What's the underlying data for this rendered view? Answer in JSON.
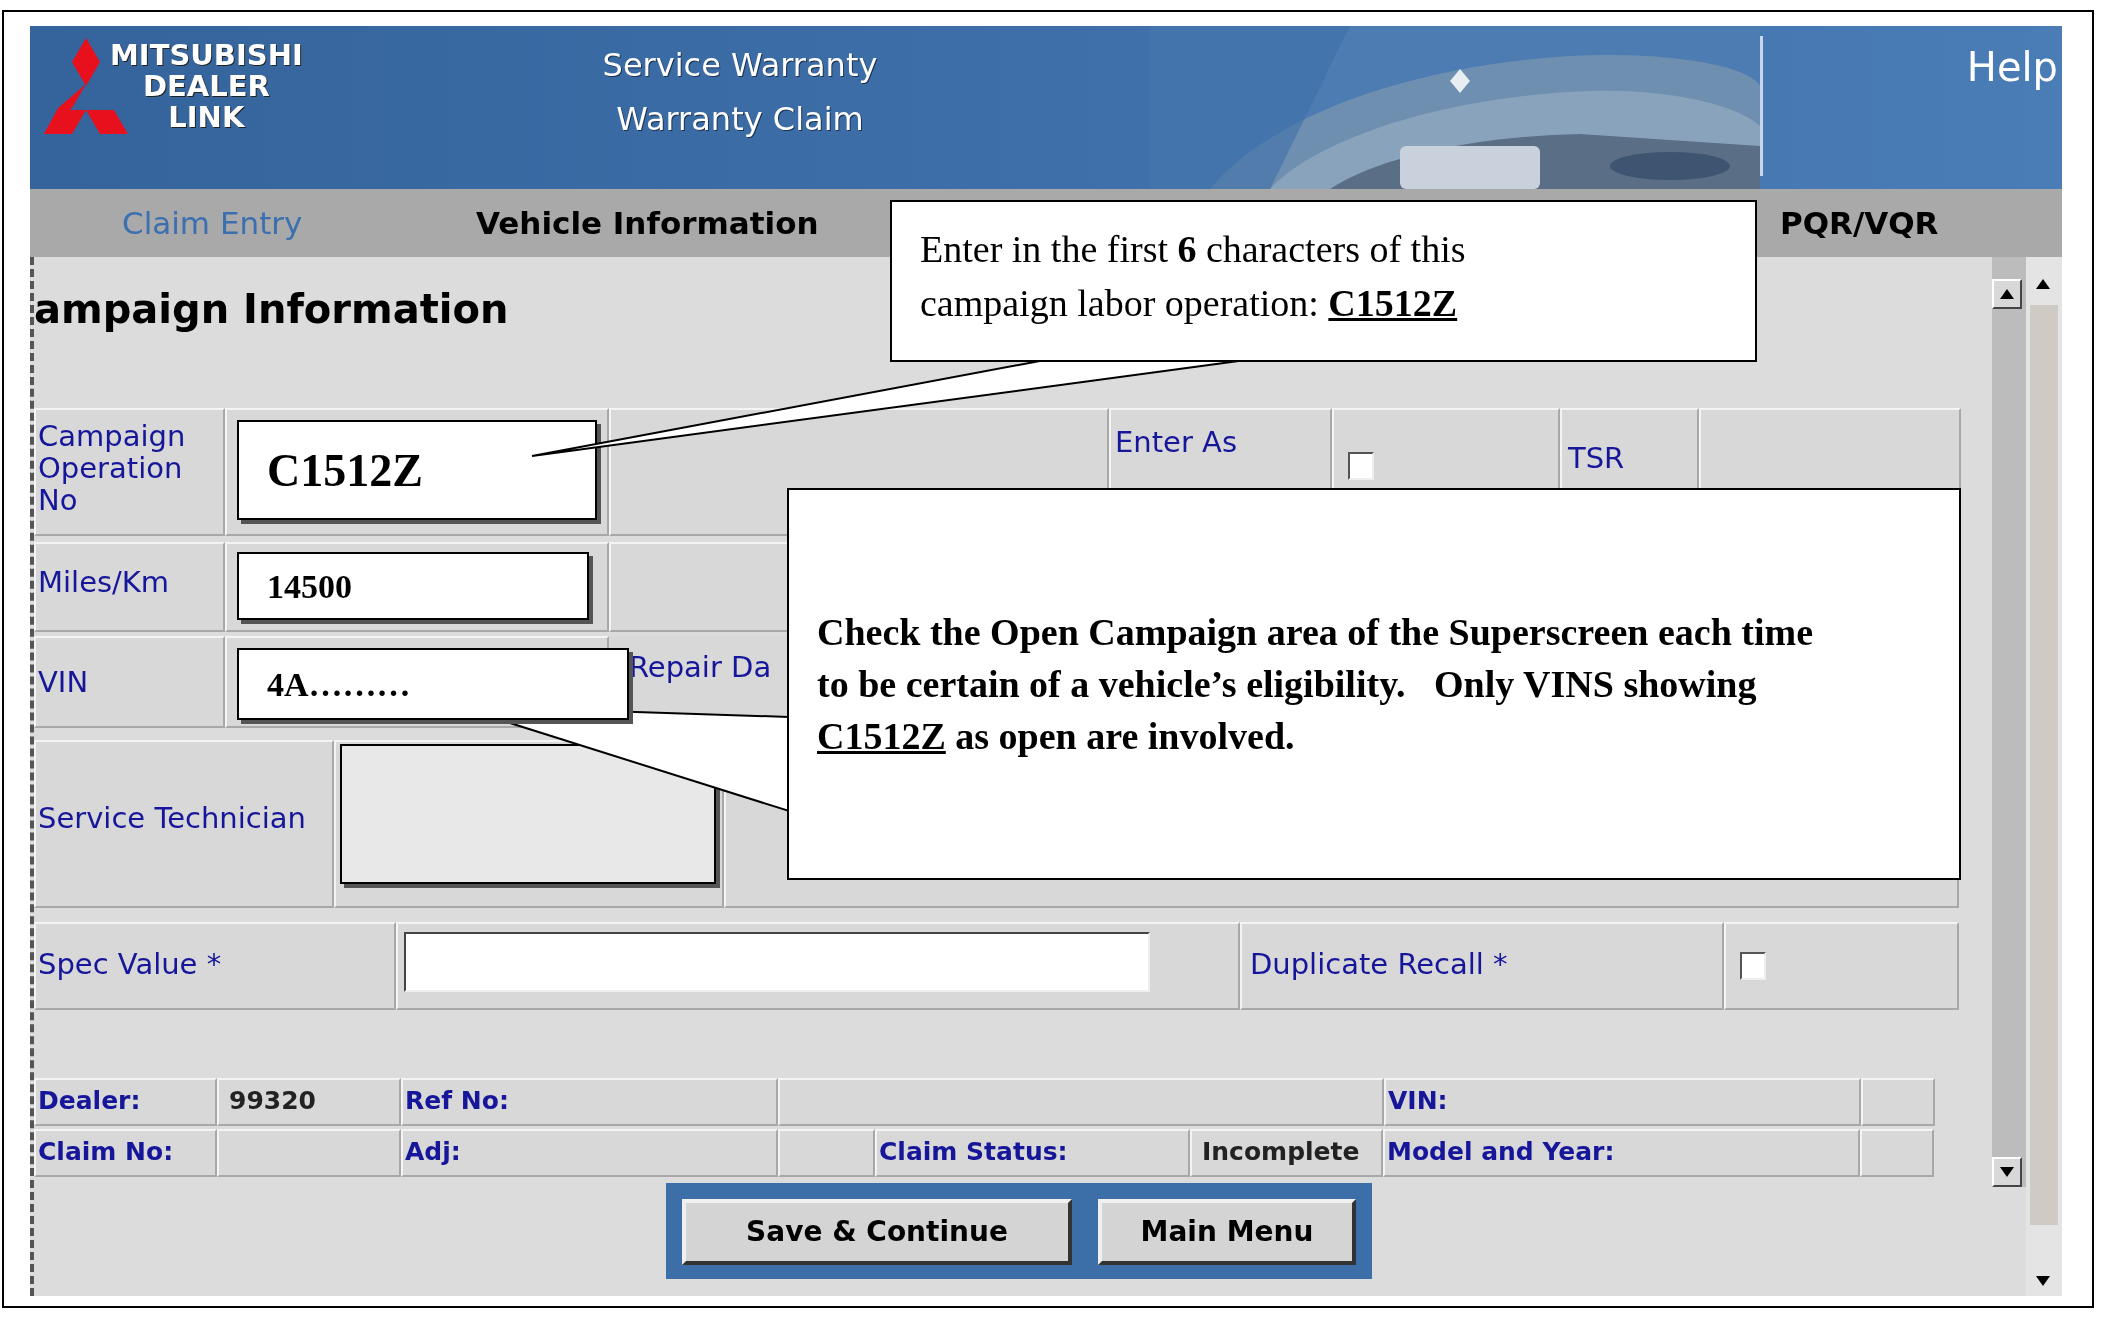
{
  "header": {
    "logo_lines": [
      "MITSUBISHI",
      "DEALER",
      "LINK"
    ],
    "title_lines": [
      "Service Warranty",
      "Warranty Claim"
    ],
    "help": "Help"
  },
  "tabs": [
    {
      "label": "Claim Entry",
      "selected": true
    },
    {
      "label": "Vehicle Information",
      "selected": false
    },
    {
      "label": "PQR/VQR",
      "selected": false
    }
  ],
  "section_title": "ampaign Information",
  "campaign_operation": {
    "label": "Campaign Operation No",
    "value": "C1512Z"
  },
  "enter_as": {
    "label": "Enter As",
    "checked": false
  },
  "tsr": {
    "label": "TSR"
  },
  "miles": {
    "label": "Miles/Km",
    "value": "14500"
  },
  "vin": {
    "label": "VIN",
    "value": "4A………"
  },
  "repair_date": {
    "label": "Repair Da"
  },
  "service_technician": {
    "label": "Service Technician"
  },
  "spec_value": {
    "label": "Spec Value *"
  },
  "duplicate_recall": {
    "label": "Duplicate Recall *",
    "checked": false
  },
  "info_rows": [
    [
      {
        "kind": "label",
        "text": "Dealer:"
      },
      {
        "kind": "value",
        "text": "99320"
      },
      {
        "kind": "label",
        "text": "Ref No:"
      },
      {
        "kind": "value"
      },
      {
        "kind": "label",
        "text": "VIN:"
      },
      {
        "kind": "value"
      }
    ],
    [
      {
        "kind": "label",
        "text": "Claim No:"
      },
      {
        "kind": "value"
      },
      {
        "kind": "label",
        "text": "Adj:"
      },
      {
        "kind": "value"
      },
      {
        "kind": "label",
        "text": "Claim Status:"
      },
      {
        "kind": "value",
        "text": "Incomplete"
      },
      {
        "kind": "label",
        "text": "Model and Year:"
      },
      {
        "kind": "value"
      }
    ]
  ],
  "buttons": [
    "Save & Continue",
    "Main Menu"
  ],
  "callouts": [
    {
      "parts": [
        {
          "kind": "plain",
          "text": "Enter in the first "
        },
        {
          "kind": "bold",
          "text": "6"
        },
        {
          "kind": "plain",
          "text": " characters of this campaign labor operation: "
        },
        {
          "kind": "link",
          "text": "C1512Z"
        }
      ]
    },
    {
      "parts": [
        {
          "kind": "bold",
          "text": "Check the Open Campaign area of the Superscreen each time to be certain of a vehicle’s eligibility.   Only VINS showing "
        },
        {
          "kind": "link",
          "text": "C1512Z"
        },
        {
          "kind": "bold",
          "text": " as open are involved."
        }
      ]
    }
  ]
}
